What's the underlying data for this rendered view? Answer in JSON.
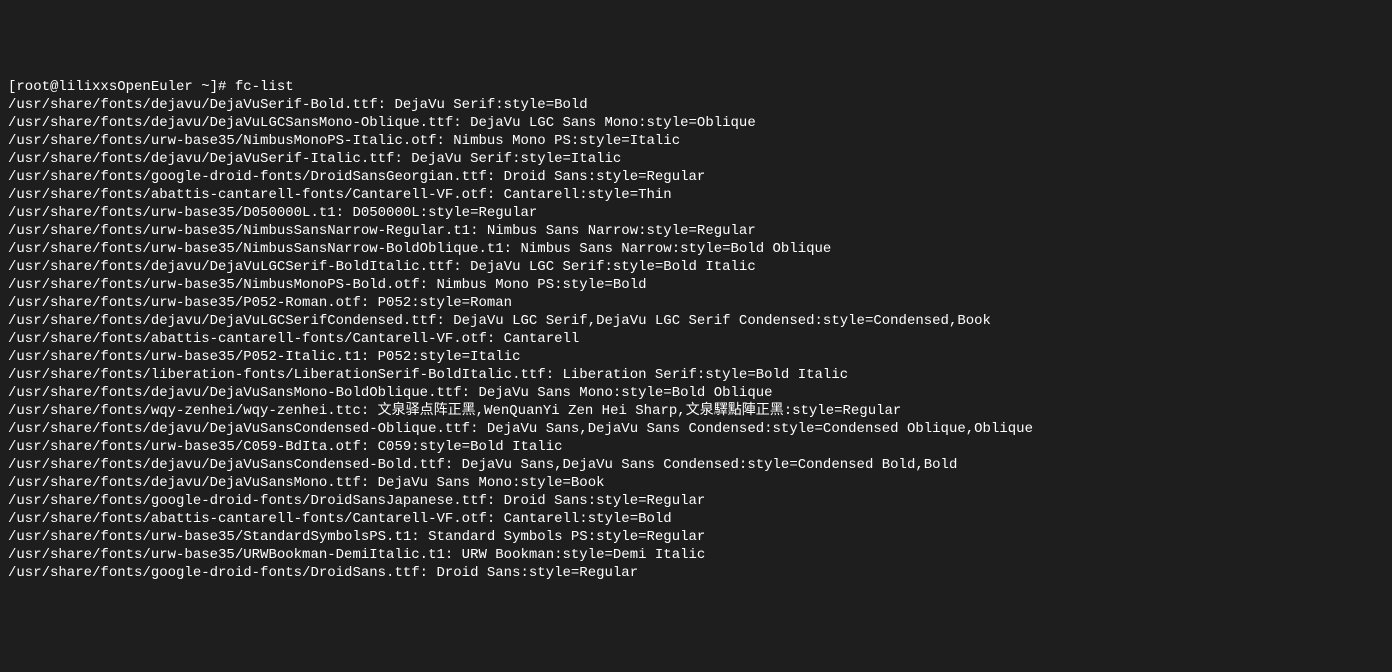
{
  "prompt": "[root@lilixxsOpenEuler ~]# fc-list",
  "lines": [
    "/usr/share/fonts/dejavu/DejaVuSerif-Bold.ttf: DejaVu Serif:style=Bold",
    "/usr/share/fonts/dejavu/DejaVuLGCSansMono-Oblique.ttf: DejaVu LGC Sans Mono:style=Oblique",
    "/usr/share/fonts/urw-base35/NimbusMonoPS-Italic.otf: Nimbus Mono PS:style=Italic",
    "/usr/share/fonts/dejavu/DejaVuSerif-Italic.ttf: DejaVu Serif:style=Italic",
    "/usr/share/fonts/google-droid-fonts/DroidSansGeorgian.ttf: Droid Sans:style=Regular",
    "/usr/share/fonts/abattis-cantarell-fonts/Cantarell-VF.otf: Cantarell:style=Thin",
    "/usr/share/fonts/urw-base35/D050000L.t1: D050000L:style=Regular",
    "/usr/share/fonts/urw-base35/NimbusSansNarrow-Regular.t1: Nimbus Sans Narrow:style=Regular",
    "/usr/share/fonts/urw-base35/NimbusSansNarrow-BoldOblique.t1: Nimbus Sans Narrow:style=Bold Oblique",
    "/usr/share/fonts/dejavu/DejaVuLGCSerif-BoldItalic.ttf: DejaVu LGC Serif:style=Bold Italic",
    "/usr/share/fonts/urw-base35/NimbusMonoPS-Bold.otf: Nimbus Mono PS:style=Bold",
    "/usr/share/fonts/urw-base35/P052-Roman.otf: P052:style=Roman",
    "/usr/share/fonts/dejavu/DejaVuLGCSerifCondensed.ttf: DejaVu LGC Serif,DejaVu LGC Serif Condensed:style=Condensed,Book",
    "/usr/share/fonts/abattis-cantarell-fonts/Cantarell-VF.otf: Cantarell",
    "/usr/share/fonts/urw-base35/P052-Italic.t1: P052:style=Italic",
    "/usr/share/fonts/liberation-fonts/LiberationSerif-BoldItalic.ttf: Liberation Serif:style=Bold Italic",
    "/usr/share/fonts/dejavu/DejaVuSansMono-BoldOblique.ttf: DejaVu Sans Mono:style=Bold Oblique",
    "/usr/share/fonts/wqy-zenhei/wqy-zenhei.ttc: 文泉驿点阵正黑,WenQuanYi Zen Hei Sharp,文泉驛點陣正黑:style=Regular",
    "/usr/share/fonts/dejavu/DejaVuSansCondensed-Oblique.ttf: DejaVu Sans,DejaVu Sans Condensed:style=Condensed Oblique,Oblique",
    "/usr/share/fonts/urw-base35/C059-BdIta.otf: C059:style=Bold Italic",
    "/usr/share/fonts/dejavu/DejaVuSansCondensed-Bold.ttf: DejaVu Sans,DejaVu Sans Condensed:style=Condensed Bold,Bold",
    "/usr/share/fonts/dejavu/DejaVuSansMono.ttf: DejaVu Sans Mono:style=Book",
    "/usr/share/fonts/google-droid-fonts/DroidSansJapanese.ttf: Droid Sans:style=Regular",
    "/usr/share/fonts/abattis-cantarell-fonts/Cantarell-VF.otf: Cantarell:style=Bold",
    "/usr/share/fonts/urw-base35/StandardSymbolsPS.t1: Standard Symbols PS:style=Regular",
    "/usr/share/fonts/urw-base35/URWBookman-DemiItalic.t1: URW Bookman:style=Demi Italic",
    "/usr/share/fonts/google-droid-fonts/DroidSans.ttf: Droid Sans:style=Regular"
  ]
}
